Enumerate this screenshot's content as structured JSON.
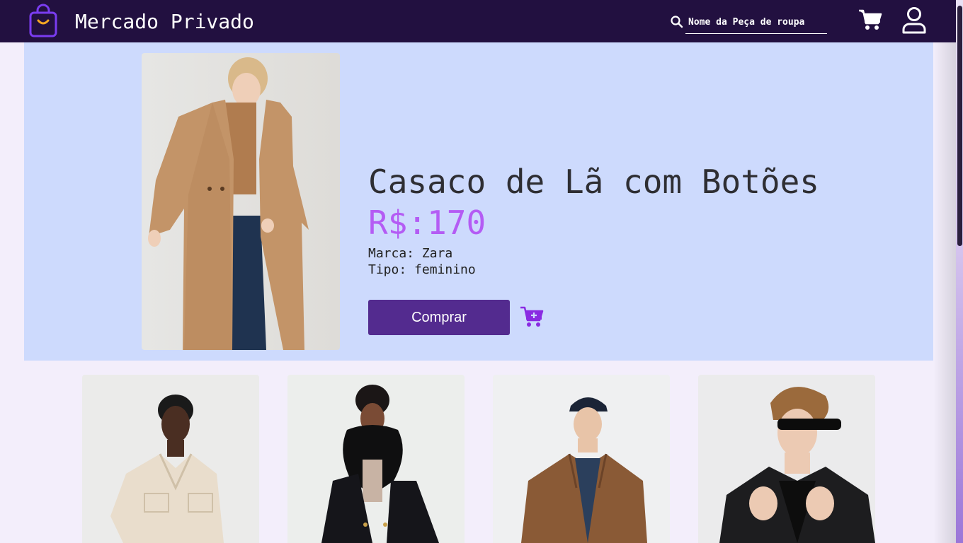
{
  "header": {
    "brand": "Mercado Privado",
    "search_placeholder": "Nome da Peça de roupa",
    "icons": {
      "logo": "shopping-bag-icon",
      "search": "search-icon",
      "cart": "cart-icon",
      "user": "user-icon"
    }
  },
  "featured": {
    "title": "Casaco de Lã com Botões",
    "price": "R$:170",
    "brand_line": "Marca: Zara",
    "type_line": "Tipo: feminino",
    "buy_label": "Comprar",
    "add_to_cart_icon": "cart-plus-icon",
    "image": "woman-camel-wool-coat-photo"
  },
  "products": [
    {
      "image": "man-cream-overshirt-photo"
    },
    {
      "image": "woman-black-fur-collar-coat-photo"
    },
    {
      "image": "man-brown-suede-jacket-cap-photo"
    },
    {
      "image": "man-black-blazer-sunglasses-photo"
    }
  ],
  "colors": {
    "navbar": "#221040",
    "hero_bg": "#cddafd",
    "page_bg": "#f3eefb",
    "price": "#b45cf4",
    "button": "#532b8f",
    "accent_icon": "#8a2be2"
  }
}
